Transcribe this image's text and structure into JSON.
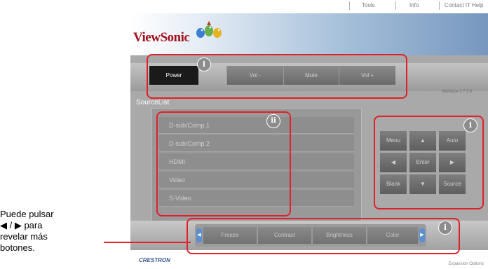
{
  "top_links": [
    "Tools",
    "Info",
    "Contact IT Help"
  ],
  "brand": {
    "logo_text": "ViewSonic"
  },
  "power_bar": {
    "buttons": [
      "Power",
      "Vol -",
      "Mute",
      "Vol +"
    ]
  },
  "interface_version": "Interface 2.7.2.6",
  "source_list": {
    "title": "SourceList",
    "items": [
      "D-sub/Comp.1",
      "D-sub/Comp.2",
      "HDMI",
      "Video",
      "S-Video"
    ]
  },
  "nav_pad": {
    "menu": "Menu",
    "auto": "Auto",
    "enter": "Enter",
    "blank": "Blank",
    "source": "Source",
    "up": "▲",
    "down": "▼",
    "left": "◀",
    "right": "▶"
  },
  "expansion": {
    "buttons": [
      "Freeze",
      "Contrast",
      "Brightness",
      "Color"
    ],
    "left_arrow": "◀",
    "right_arrow": "▶"
  },
  "footer": {
    "crestron": "CRESTRON",
    "expansion_options": "Expansion Options"
  },
  "badges": {
    "i": "i",
    "ii": "ii"
  },
  "annotation": {
    "line1": "Puede pulsar",
    "line2": "◀ / ▶ para",
    "line3": "revelar más",
    "line4": "botones."
  },
  "colors": {
    "highlight": "#e0202a",
    "logo": "#a3121e"
  }
}
